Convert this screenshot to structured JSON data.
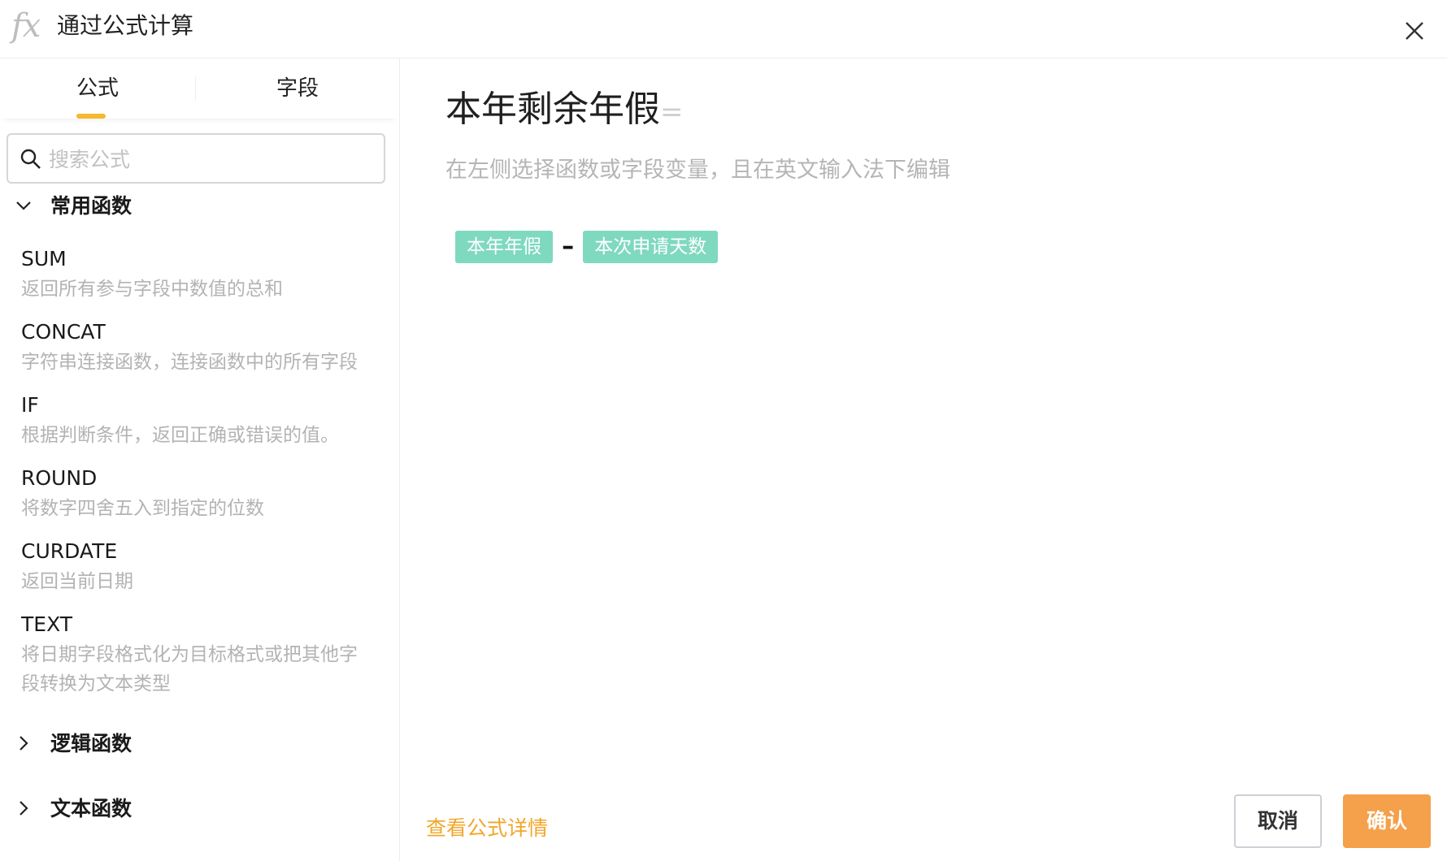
{
  "header": {
    "icon_text": "fx",
    "title": "通过公式计算"
  },
  "left_panel": {
    "tabs": [
      {
        "label": "公式",
        "active": true
      },
      {
        "label": "字段",
        "active": false
      }
    ],
    "search": {
      "placeholder": "搜索公式",
      "value": ""
    },
    "groups": [
      {
        "title": "常用函数",
        "expanded": true
      },
      {
        "title": "逻辑函数",
        "expanded": false
      },
      {
        "title": "文本函数",
        "expanded": false
      }
    ],
    "functions": [
      {
        "name": "SUM",
        "desc": "返回所有参与字段中数值的总和"
      },
      {
        "name": "CONCAT",
        "desc": "字符串连接函数，连接函数中的所有字段"
      },
      {
        "name": "IF",
        "desc": "根据判断条件，返回正确或错误的值。"
      },
      {
        "name": "ROUND",
        "desc": "将数字四舍五入到指定的位数"
      },
      {
        "name": "CURDATE",
        "desc": "返回当前日期"
      },
      {
        "name": "TEXT",
        "desc_line1": "将日期字段格式化为目标格式或把其他字",
        "desc_line2": "段转换为文本类型"
      }
    ]
  },
  "editor": {
    "field_name": "本年剩余年假",
    "equals": "=",
    "hint": "在左侧选择函数或字段变量，且在英文输入法下编辑",
    "tokens": [
      {
        "label": "本年年假",
        "type": "field"
      },
      {
        "label": "–",
        "type": "operator"
      },
      {
        "label": "本次申请天数",
        "type": "field"
      }
    ],
    "details_link": "查看公式详情"
  },
  "footer": {
    "cancel_label": "取消",
    "confirm_label": "确认"
  },
  "colors": {
    "accent_orange": "#f5a04a",
    "tab_underline": "#f5b82e",
    "token_bg": "#7fd9bf",
    "link": "#f2a62a"
  }
}
